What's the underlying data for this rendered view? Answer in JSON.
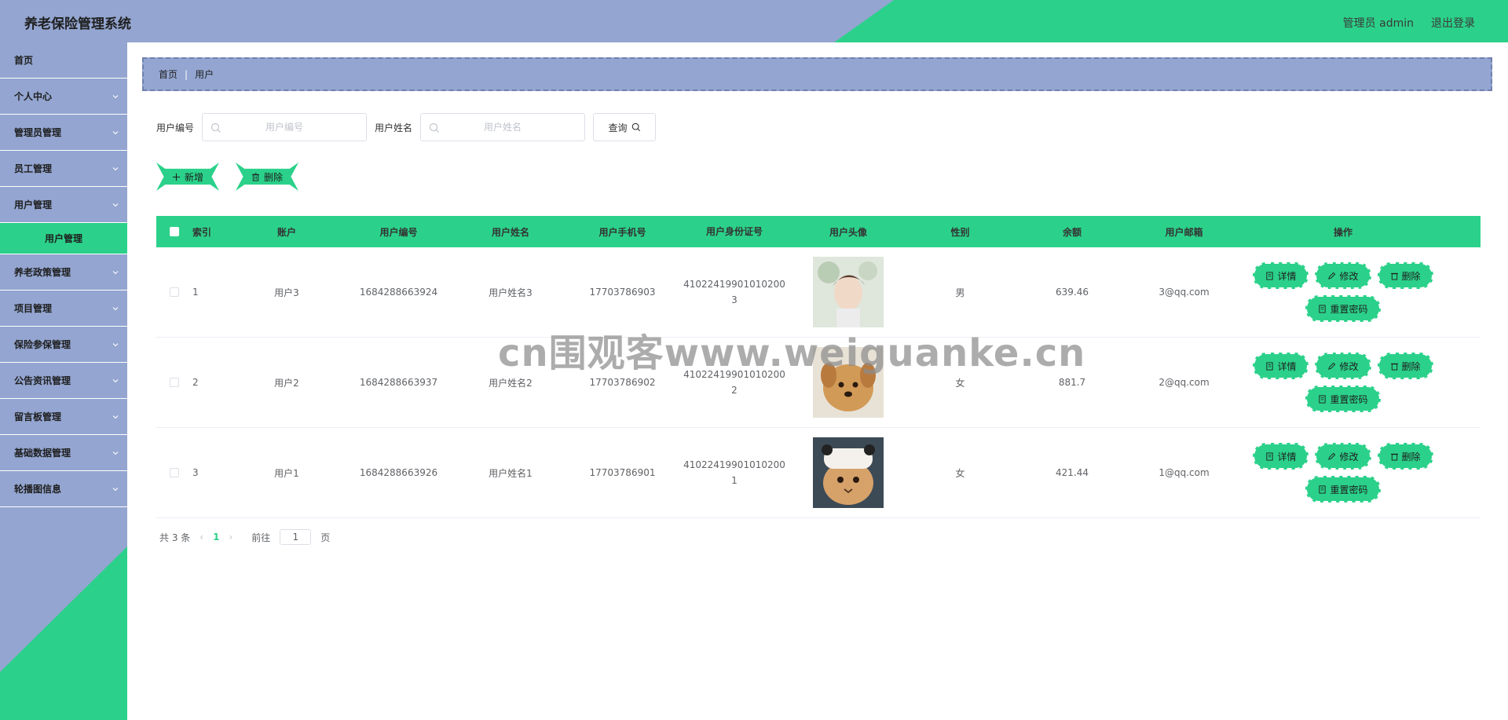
{
  "app": {
    "title": "养老保险管理系统"
  },
  "header": {
    "user_label": "管理员 admin",
    "logout_label": "退出登录"
  },
  "sidebar": {
    "items": [
      {
        "label": "首页",
        "has_arrow": false
      },
      {
        "label": "个人中心",
        "has_arrow": true
      },
      {
        "label": "管理员管理",
        "has_arrow": true
      },
      {
        "label": "员工管理",
        "has_arrow": true
      },
      {
        "label": "用户管理",
        "has_arrow": true
      },
      {
        "label": "用户管理",
        "is_sub": true,
        "active": true
      },
      {
        "label": "养老政策管理",
        "has_arrow": true
      },
      {
        "label": "项目管理",
        "has_arrow": true
      },
      {
        "label": "保险参保管理",
        "has_arrow": true
      },
      {
        "label": "公告资讯管理",
        "has_arrow": true
      },
      {
        "label": "留言板管理",
        "has_arrow": true
      },
      {
        "label": "基础数据管理",
        "has_arrow": true
      },
      {
        "label": "轮播图信息",
        "has_arrow": true
      }
    ]
  },
  "breadcrumb": {
    "home": "首页",
    "separator": "|",
    "current": "用户"
  },
  "search": {
    "user_no_label": "用户编号",
    "user_no_placeholder": "用户编号",
    "user_name_label": "用户姓名",
    "user_name_placeholder": "用户姓名",
    "query_label": "查询"
  },
  "actions": {
    "add_label": "新增",
    "delete_label": "删除"
  },
  "table": {
    "headers": [
      "索引",
      "账户",
      "用户编号",
      "用户姓名",
      "用户手机号",
      "用户身份证号",
      "用户头像",
      "性别",
      "余额",
      "用户邮箱",
      "操作"
    ],
    "rows": [
      {
        "index": "1",
        "account": "用户3",
        "user_no": "1684288663924",
        "name": "用户姓名3",
        "phone": "17703786903",
        "id_line1": "41022419901010200",
        "id_line2": "3",
        "gender": "男",
        "balance": "639.46",
        "email": "3@qq.com"
      },
      {
        "index": "2",
        "account": "用户2",
        "user_no": "1684288663937",
        "name": "用户姓名2",
        "phone": "17703786902",
        "id_line1": "41022419901010200",
        "id_line2": "2",
        "gender": "女",
        "balance": "881.7",
        "email": "2@qq.com"
      },
      {
        "index": "3",
        "account": "用户1",
        "user_no": "1684288663926",
        "name": "用户姓名1",
        "phone": "17703786901",
        "id_line1": "41022419901010200",
        "id_line2": "1",
        "gender": "女",
        "balance": "421.44",
        "email": "1@qq.com"
      }
    ],
    "row_actions": {
      "detail": "详情",
      "edit": "修改",
      "delete": "删除",
      "reset_pwd": "重置密码"
    }
  },
  "pagination": {
    "total_text": "共 3 条",
    "current_page": "1",
    "goto_prefix": "前往",
    "goto_value": "1",
    "goto_suffix": "页"
  },
  "watermark": "cn围观客www.weiguanke.cn",
  "colors": {
    "accent": "#2bd18a",
    "nav": "#93a5d0",
    "white": "#ffffff"
  }
}
